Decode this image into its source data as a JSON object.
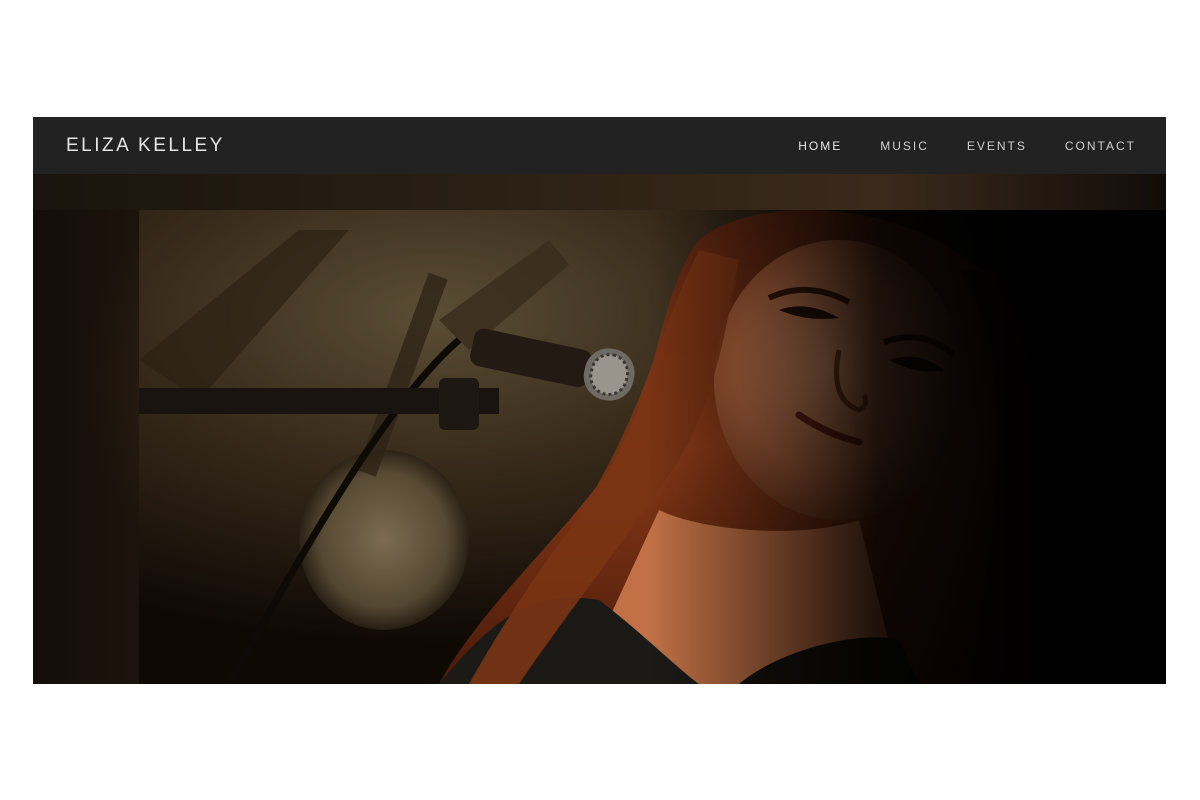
{
  "header": {
    "brand": "ELIZA KELLEY",
    "nav": [
      {
        "label": "HOME",
        "active": true
      },
      {
        "label": "MUSIC",
        "active": false
      },
      {
        "label": "EVENTS",
        "active": false
      },
      {
        "label": "CONTACT",
        "active": false
      }
    ]
  },
  "colors": {
    "header_bg": "#222222",
    "brand_text": "#e6e6e6",
    "nav_text": "#cfcfcf",
    "hero_bg": "#000000"
  },
  "hero": {
    "image": "performer-photo"
  }
}
